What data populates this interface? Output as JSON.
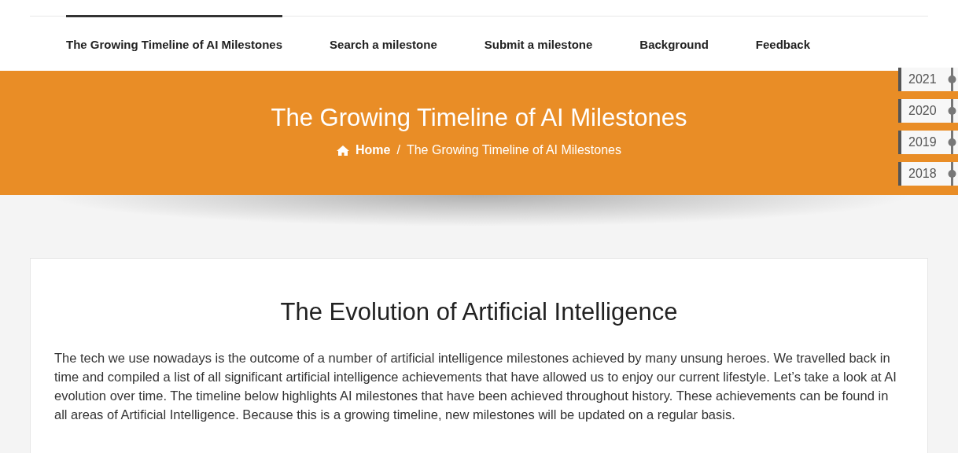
{
  "nav": [
    {
      "label": "The Growing Timeline of AI Milestones",
      "selected": true
    },
    {
      "label": "Search a milestone",
      "selected": false
    },
    {
      "label": "Submit a milestone",
      "selected": false
    },
    {
      "label": "Background",
      "selected": false
    },
    {
      "label": "Feedback",
      "selected": false
    }
  ],
  "banner": {
    "title": "The Growing Timeline of AI Milestones",
    "breadcrumb": [
      {
        "label": "Home"
      },
      {
        "label": "/"
      },
      {
        "label": "The Growing Timeline of AI Milestones"
      }
    ]
  },
  "years": [
    {
      "label": "2021"
    },
    {
      "label": "2020"
    },
    {
      "label": "2019"
    },
    {
      "label": "2018"
    }
  ],
  "article": {
    "heading": "The Evolution of Artificial Intelligence",
    "paragraph": "The tech we use nowadays is the outcome of a number of artificial intelligence milestones achieved by many unsung heroes. We travelled back in time and compiled a list of all significant artificial intelligence achievements that have allowed us to enjoy our current lifestyle. Let’s take a look at AI evolution over time. The timeline below highlights AI milestones that have been achieved throughout history. These achievements can be found in all areas of Artificial Intelligence. Because this is a growing timeline, new milestones will be updated on a regular basis."
  }
}
